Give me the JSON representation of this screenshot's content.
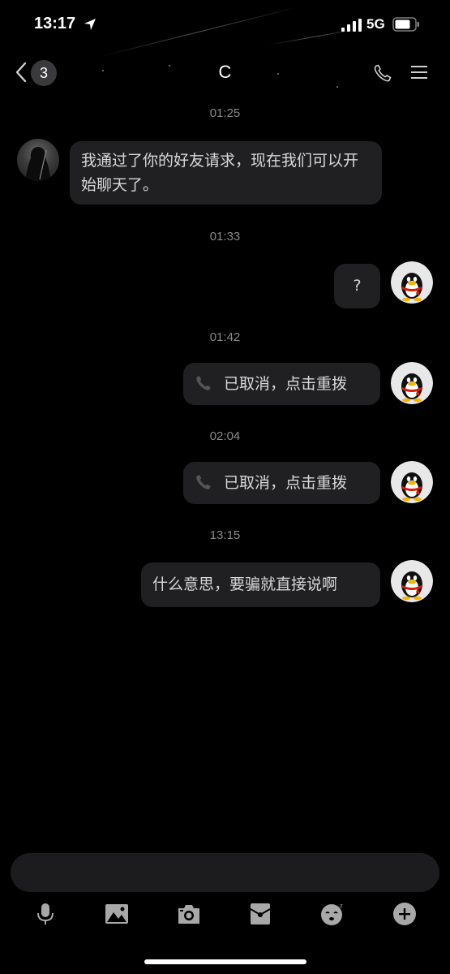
{
  "status_bar": {
    "time": "13:17",
    "network": "5G"
  },
  "nav": {
    "back_count": "3",
    "title": "C"
  },
  "messages": [
    {
      "type": "timestamp",
      "text": "01:25"
    },
    {
      "type": "incoming",
      "text": "我通过了你的好友请求，现在我们可以开始聊天了。"
    },
    {
      "type": "timestamp",
      "text": "01:33"
    },
    {
      "type": "outgoing",
      "text": "?"
    },
    {
      "type": "timestamp",
      "text": "01:42"
    },
    {
      "type": "outgoing-call",
      "text": "已取消，点击重拨"
    },
    {
      "type": "timestamp",
      "text": "02:04"
    },
    {
      "type": "outgoing-call",
      "text": "已取消，点击重拨"
    },
    {
      "type": "timestamp",
      "text": "13:15"
    },
    {
      "type": "outgoing",
      "text": "什么意思，要骗就直接说啊"
    }
  ],
  "toolbar_icons": [
    "microphone-icon",
    "image-icon",
    "camera-icon",
    "red-packet-icon",
    "emoji-icon",
    "plus-icon"
  ],
  "colors": {
    "background": "#000000",
    "bubble": "#202022",
    "timestamp": "#8a8a8e",
    "penguin_scarf": "#d81e06"
  }
}
